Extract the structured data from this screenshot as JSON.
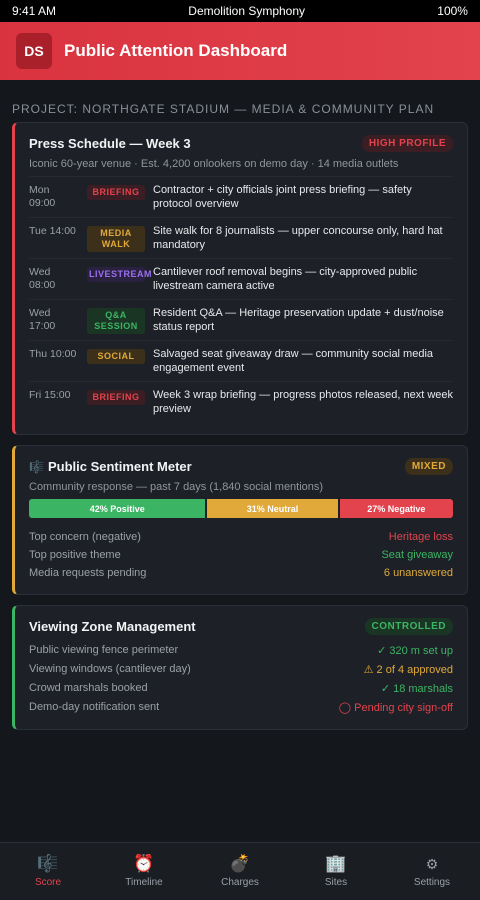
{
  "status_bar": {
    "time": "9:41 AM",
    "app": "Demolition Symphony",
    "battery": "100%"
  },
  "header": {
    "logo": "DS",
    "title": "Public Attention Dashboard"
  },
  "project_label": "PROJECT: NORTHGATE STADIUM — MEDIA & COMMUNITY PLAN",
  "press": {
    "title": "Press Schedule — Week 3",
    "badge": "HIGH PROFILE",
    "subtitle": "Iconic 60-year venue · Est. 4,200 onlookers on demo day · 14 media outlets",
    "rows": [
      {
        "time": "Mon\n09:00",
        "tag": "BRIEFING",
        "text": "Contractor + city officials joint press briefing — safety protocol overview"
      },
      {
        "time": "Tue 14:00",
        "tag": "MEDIA\nWALK",
        "text": "Site walk for 8 journalists — upper concourse only, hard hat mandatory"
      },
      {
        "time": "Wed\n08:00",
        "tag": "LIVESTREAM",
        "text": "Cantilever roof removal begins — city-approved public livestream camera active"
      },
      {
        "time": "Wed\n17:00",
        "tag": "Q&A\nSESSION",
        "text": "Resident Q&A — Heritage preservation update + dust/noise status report"
      },
      {
        "time": "Thu 10:00",
        "tag": "SOCIAL",
        "text": "Salvaged seat giveaway draw — community social media engagement event"
      },
      {
        "time": "Fri 15:00",
        "tag": "BRIEFING",
        "text": "Week 3 wrap briefing — progress photos released, next week preview"
      }
    ]
  },
  "sentiment": {
    "icon": "music-score-icon",
    "title": "Public Sentiment Meter",
    "badge": "MIXED",
    "subtitle": "Community response — past 7 days (1,840 social mentions)",
    "positive": {
      "label": "42% Positive",
      "pct": 42
    },
    "neutral": {
      "label": "31% Neutral",
      "pct": 31
    },
    "negative": {
      "label": "27% Negative",
      "pct": 27
    },
    "rows": [
      {
        "k": "Top concern (negative)",
        "v": "Heritage loss"
      },
      {
        "k": "Top positive theme",
        "v": "Seat giveaway"
      },
      {
        "k": "Media requests pending",
        "v": "6 unanswered"
      }
    ]
  },
  "viewing": {
    "title": "Viewing Zone Management",
    "badge": "CONTROLLED",
    "rows": [
      {
        "k": "Public viewing fence perimeter",
        "v": "✓ 320 m set up"
      },
      {
        "k": "Viewing windows (cantilever day)",
        "v": "⚠ 2 of 4 approved"
      },
      {
        "k": "Crowd marshals booked",
        "v": "✓ 18 marshals"
      },
      {
        "k": "Demo-day notification sent",
        "v": "◯ Pending city sign-off"
      }
    ]
  },
  "nav": [
    {
      "label": "Score",
      "icon": "🎼"
    },
    {
      "label": "Timeline",
      "icon": "⏰"
    },
    {
      "label": "Charges",
      "icon": "💣"
    },
    {
      "label": "Sites",
      "icon": "🏢"
    },
    {
      "label": "Settings",
      "icon": "⚙"
    }
  ],
  "colors": {
    "accent": "#e2434d",
    "amber": "#e0a93a",
    "green": "#3bb463",
    "purple": "#9a6ff0"
  }
}
